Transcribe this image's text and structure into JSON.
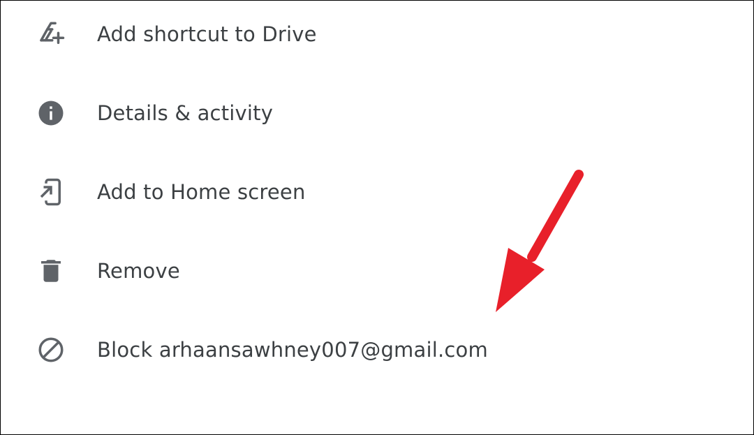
{
  "menu": {
    "items": [
      {
        "label": "Add shortcut to Drive",
        "icon": "drive-shortcut-add-icon"
      },
      {
        "label": "Details & activity",
        "icon": "info-icon"
      },
      {
        "label": "Add to Home screen",
        "icon": "add-to-home-screen-icon"
      },
      {
        "label": "Remove",
        "icon": "trash-icon"
      },
      {
        "label": "Block arhaansawhney007@gmail.com",
        "icon": "block-icon"
      }
    ]
  },
  "colors": {
    "text": "#3c4043",
    "icon": "#5f6368",
    "annotation_arrow": "#e8202a",
    "background": "#ffffff",
    "border": "#000000"
  }
}
